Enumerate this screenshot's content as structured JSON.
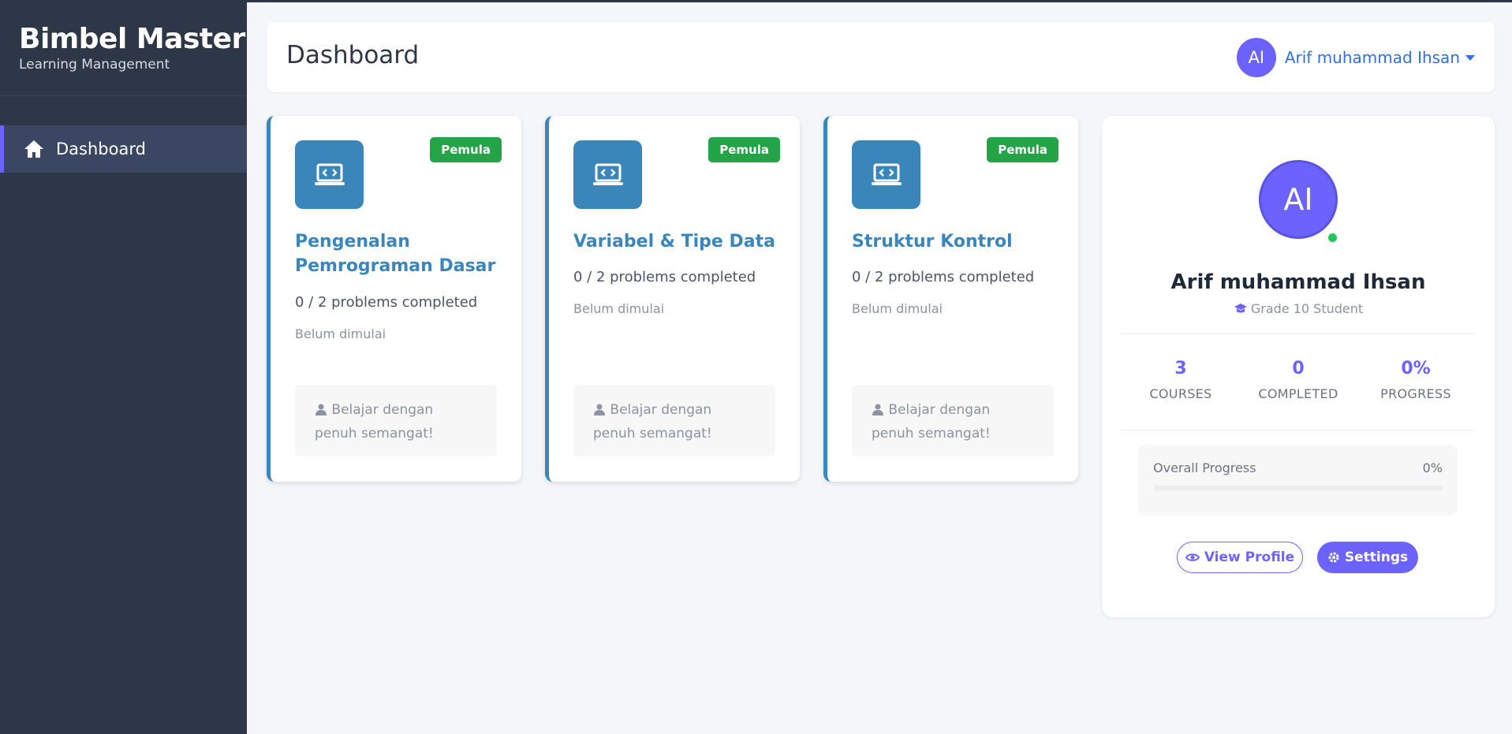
{
  "brand": {
    "title": "Bimbel Master",
    "subtitle": "Learning Management"
  },
  "sidebar": {
    "items": [
      {
        "label": "Dashboard",
        "icon": "home-icon",
        "active": true
      }
    ]
  },
  "header": {
    "title": "Dashboard",
    "user": {
      "initials": "AI",
      "name": "Arif muhammad Ihsan"
    }
  },
  "courses": [
    {
      "level": "Pemula",
      "title": "Pengenalan Pemrograman Dasar",
      "progress": "0 / 2 problems completed",
      "status": "Belum dimulai",
      "motivation": "Belajar dengan penuh semangat!",
      "icon": "laptop-code-icon"
    },
    {
      "level": "Pemula",
      "title": "Variabel & Tipe Data",
      "progress": "0 / 2 problems completed",
      "status": "Belum dimulai",
      "motivation": "Belajar dengan penuh semangat!",
      "icon": "laptop-code-icon"
    },
    {
      "level": "Pemula",
      "title": "Struktur Kontrol",
      "progress": "0 / 2 problems completed",
      "status": "Belum dimulai",
      "motivation": "Belajar dengan penuh semangat!",
      "icon": "laptop-code-icon"
    }
  ],
  "profile": {
    "initials": "AI",
    "name": "Arif muhammad Ihsan",
    "role": "Grade 10 Student",
    "stats": [
      {
        "value": "3",
        "label": "COURSES"
      },
      {
        "value": "0",
        "label": "COMPLETED"
      },
      {
        "value": "0%",
        "label": "PROGRESS"
      }
    ],
    "overall_label": "Overall Progress",
    "overall_value": "0%",
    "overall_fraction": 0,
    "view_profile_label": "View Profile",
    "settings_label": "Settings"
  },
  "colors": {
    "accent": "#6c63ff",
    "course": "#3a86bb",
    "badge": "#22a447",
    "sidebar": "#2d3748"
  }
}
